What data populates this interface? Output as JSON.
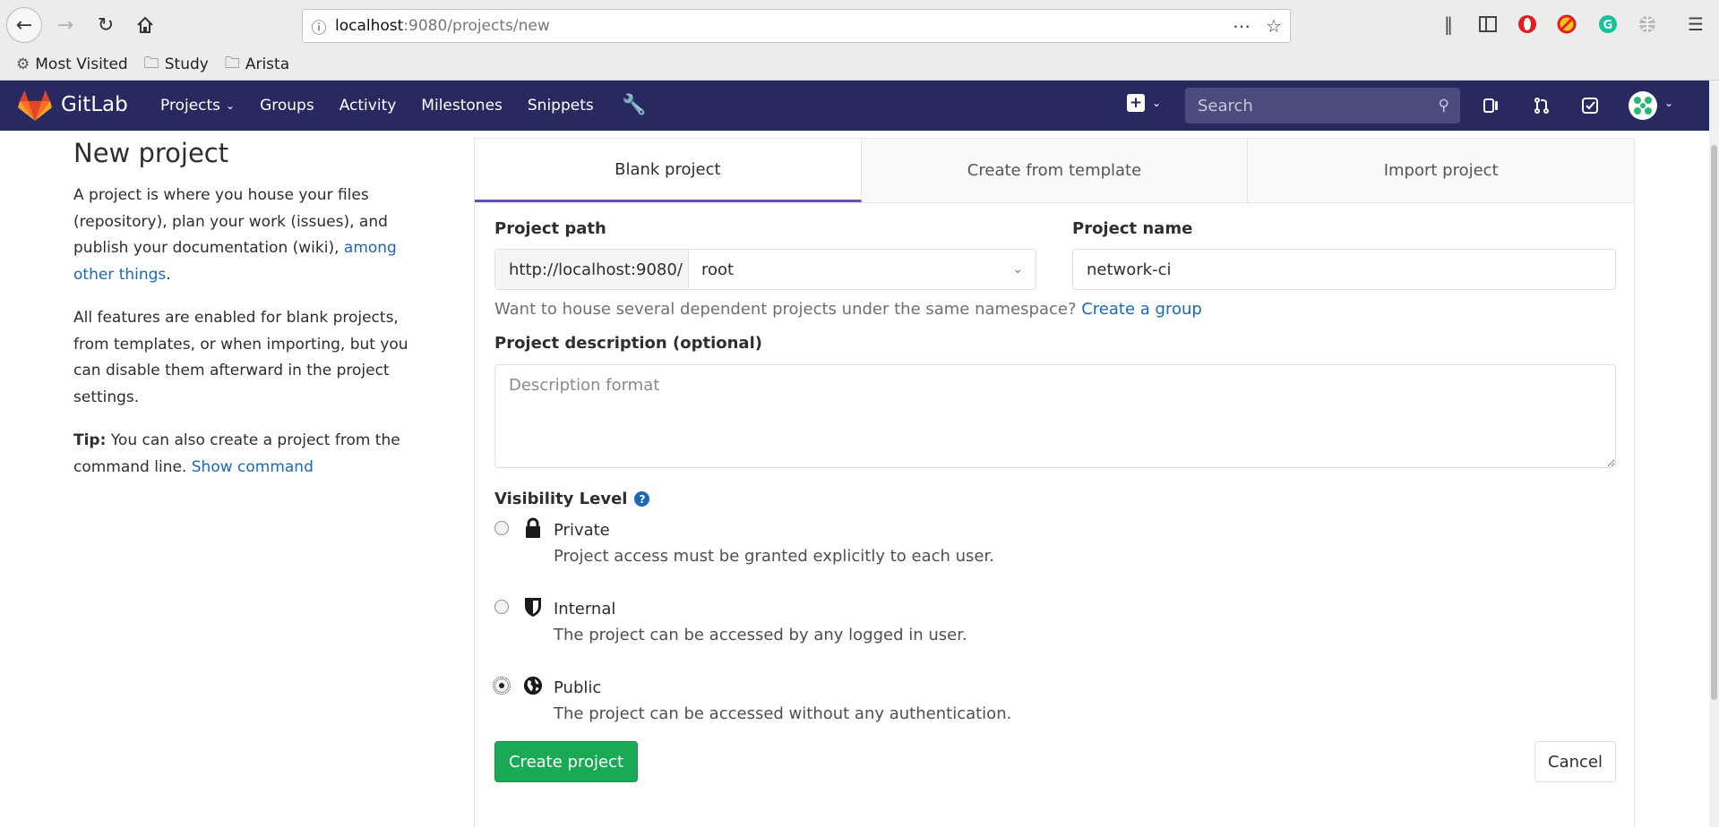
{
  "browser": {
    "url_host": "localhost",
    "url_rest": ":9080/projects/new",
    "bookmarks": [
      {
        "label": "Most Visited",
        "icon": "gear-icon"
      },
      {
        "label": "Study",
        "icon": "folder-icon"
      },
      {
        "label": "Arista",
        "icon": "folder-icon"
      }
    ]
  },
  "navbar": {
    "brand": "GitLab",
    "menu": [
      "Projects",
      "Groups",
      "Activity",
      "Milestones",
      "Snippets"
    ],
    "search_placeholder": "Search",
    "colors": {
      "bg": "#292961",
      "search_bg": "#4b4b7d"
    }
  },
  "sidebar": {
    "title": "New project",
    "p1_text": "A project is where you house your files (repository), plan your work (issues), and publish your documentation (wiki), ",
    "p1_link": "among other things",
    "p1_end": ".",
    "p2_text": "All features are enabled for blank projects, from templates, or when importing, but you can disable them afterward in the project settings.",
    "tip_label": "Tip:",
    "tip_text": " You can also create a project from the command line. ",
    "tip_link": "Show command"
  },
  "tabs": [
    "Blank project",
    "Create from template",
    "Import project"
  ],
  "form": {
    "path_label": "Project path",
    "path_prefix": "http://localhost:9080/",
    "path_namespace": "root",
    "name_label": "Project name",
    "name_value": "network-ci",
    "help_text": "Want to house several dependent projects under the same namespace? ",
    "help_link": "Create a group",
    "desc_label": "Project description (optional)",
    "desc_placeholder": "Description format",
    "visibility_label": "Visibility Level",
    "options": [
      {
        "title": "Private",
        "desc": "Project access must be granted explicitly to each user.",
        "icon": "lock-icon",
        "checked": false
      },
      {
        "title": "Internal",
        "desc": "The project can be accessed by any logged in user.",
        "icon": "shield-icon",
        "checked": false
      },
      {
        "title": "Public",
        "desc": "The project can be accessed without any authentication.",
        "icon": "globe-icon",
        "checked": true
      }
    ],
    "create_label": "Create project",
    "cancel_label": "Cancel"
  },
  "colors": {
    "accent": "#1aaa55",
    "link": "#1b69b6",
    "tab_active": "#6b4fbb"
  }
}
